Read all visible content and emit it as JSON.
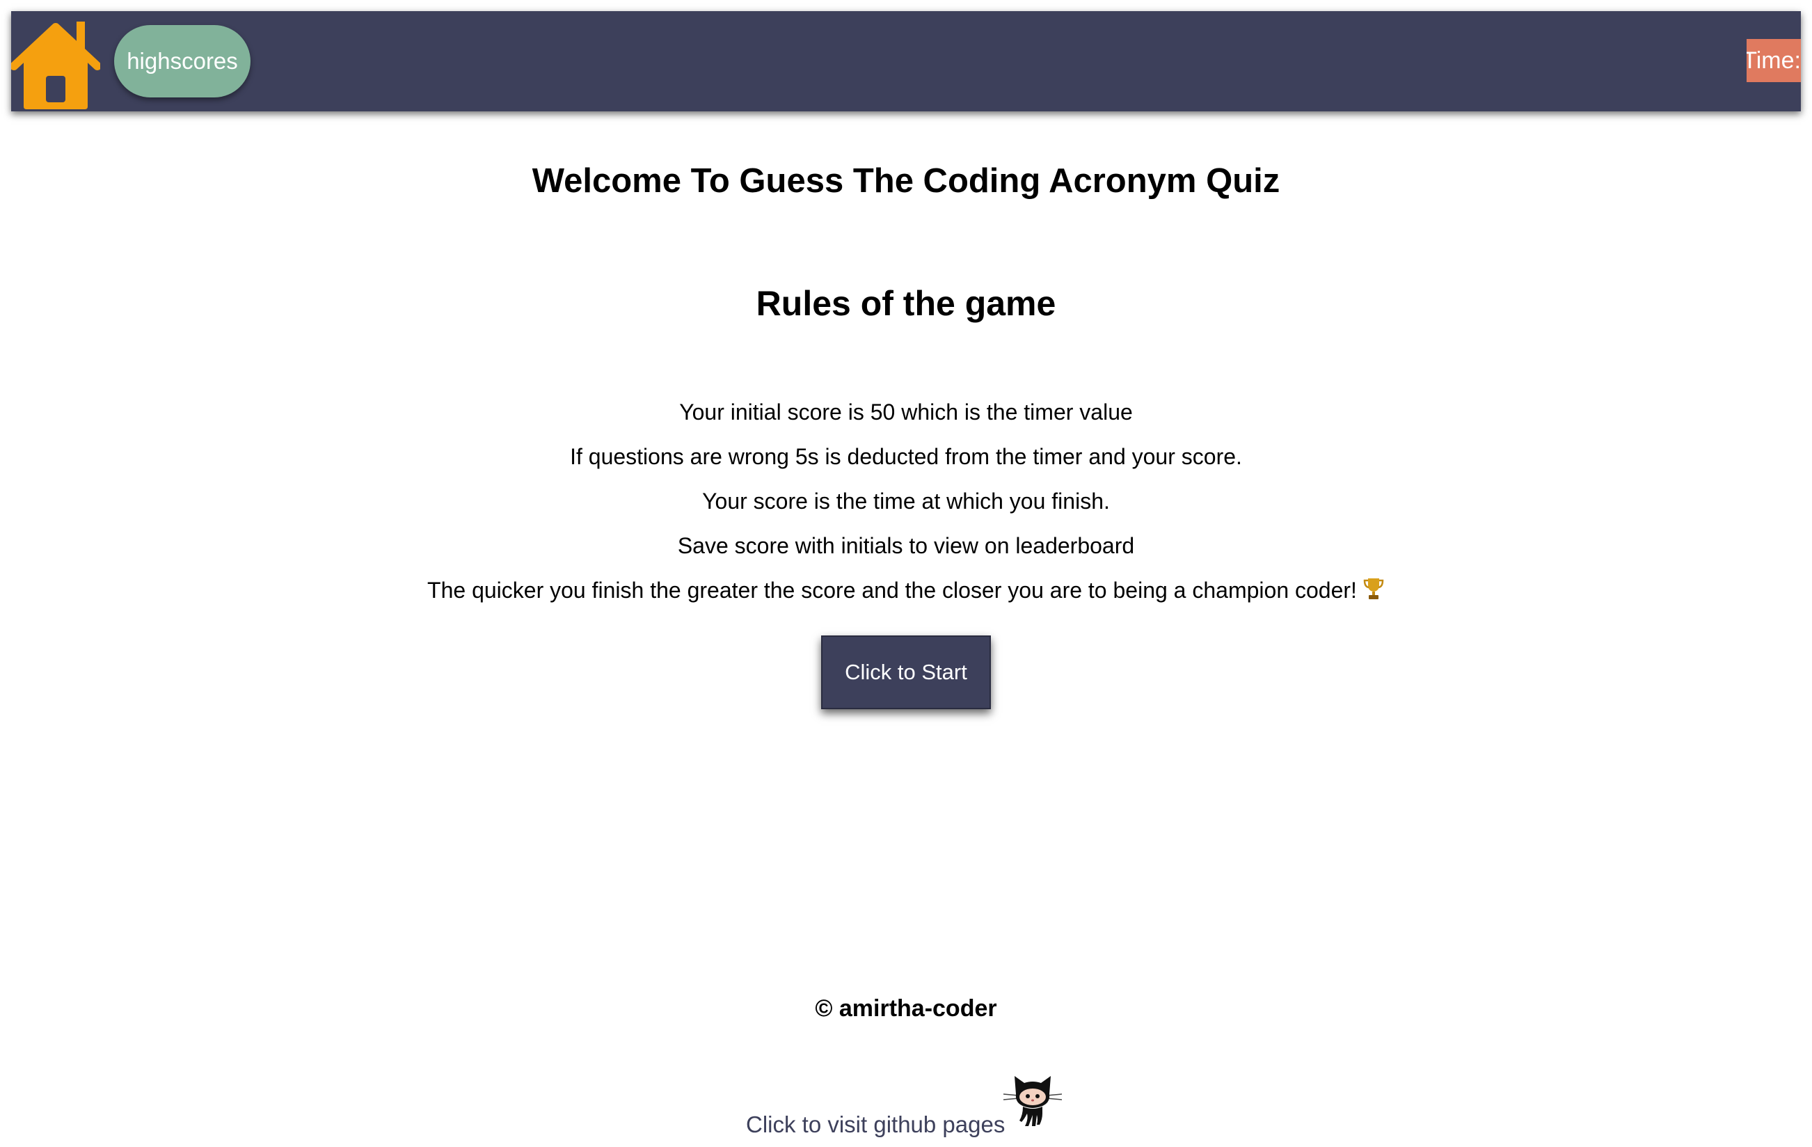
{
  "header": {
    "home_icon": "home-icon",
    "highscores_label": "highscores",
    "timer_label": "Time:",
    "colors": {
      "navbar": "#3d405b",
      "home_icon": "#f5a00f",
      "highscores_bg": "#81b29a",
      "timer_bg": "#e07a5f"
    }
  },
  "main": {
    "title": "Welcome To Guess The Coding Acronym Quiz",
    "rules_heading": "Rules of the game",
    "rules": [
      "Your initial score is 50 which is the timer value",
      "If questions are wrong 5s is deducted from the timer and your score.",
      "Your score is the time at which you finish.",
      "Save score with initials to view on leaderboard",
      "The quicker you finish the greater the score and the closer you are to being a champion coder!"
    ],
    "rules_last_icon": "trophy-icon",
    "start_button_label": "Click to Start"
  },
  "footer": {
    "copyright": "© amirtha-coder",
    "github_link_text": "Click to visit github pages",
    "github_icon": "github-octocat-icon"
  }
}
